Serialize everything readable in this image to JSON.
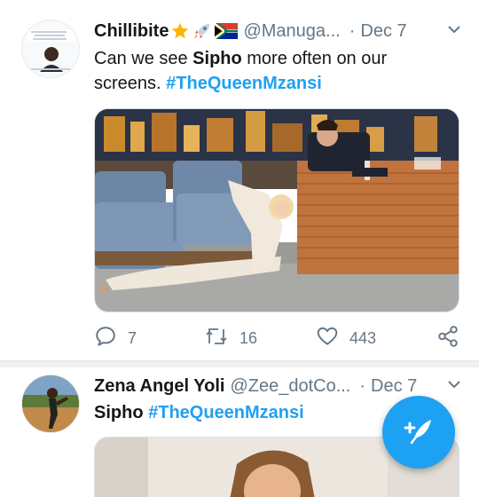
{
  "tweets": [
    {
      "display_name": "Chillibite",
      "badges": [
        "star-icon",
        "rocket-icon",
        "south-africa-flag-icon"
      ],
      "handle": "@Manuga...",
      "separator": "·",
      "date": "Dec 7",
      "text_parts": [
        "Can we see ",
        "Sipho",
        " more often on our screens.  ",
        "#TheQueenMzansi"
      ],
      "reply_count": "7",
      "retweet_count": "16",
      "like_count": "443",
      "media_icon": "talk-show-photo"
    },
    {
      "display_name": "Zena Angel Yoli",
      "handle": "@Zee_dotCo...",
      "separator": "·",
      "date": "Dec 7",
      "text_parts": [
        "Sipho",
        " ",
        "#TheQueenMzansi"
      ],
      "media_icon": "photo"
    }
  ],
  "colors": {
    "accent": "#1da1f2",
    "muted": "#657786",
    "text": "#14171a",
    "separator": "#eef0f2"
  },
  "fab": {
    "icon": "compose-tweet-icon"
  }
}
